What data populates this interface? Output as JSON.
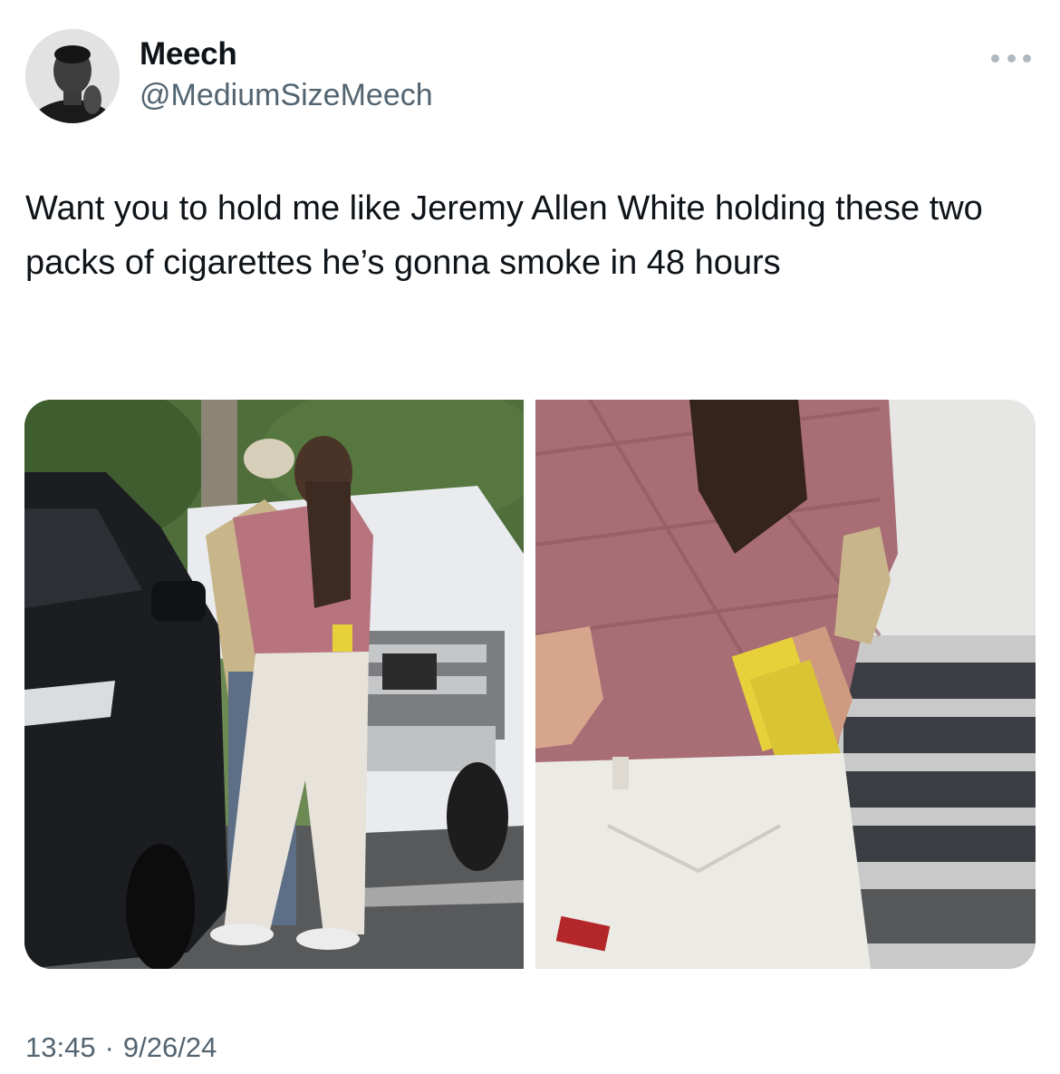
{
  "author": {
    "display_name": "Meech",
    "handle": "@MediumSizeMeech",
    "avatar_icon": "user-avatar"
  },
  "more_icon": "more-options-icon",
  "tweet_text": "Want you to hold me like Jeremy Allen White holding these two packs of cigarettes he’s gonna smoke in 48 hours",
  "media": {
    "count": 2
  },
  "meta": {
    "time": "13:45",
    "separator": "·",
    "date": "9/26/24"
  },
  "colors": {
    "text": "#0f1419",
    "secondary": "#536471"
  }
}
